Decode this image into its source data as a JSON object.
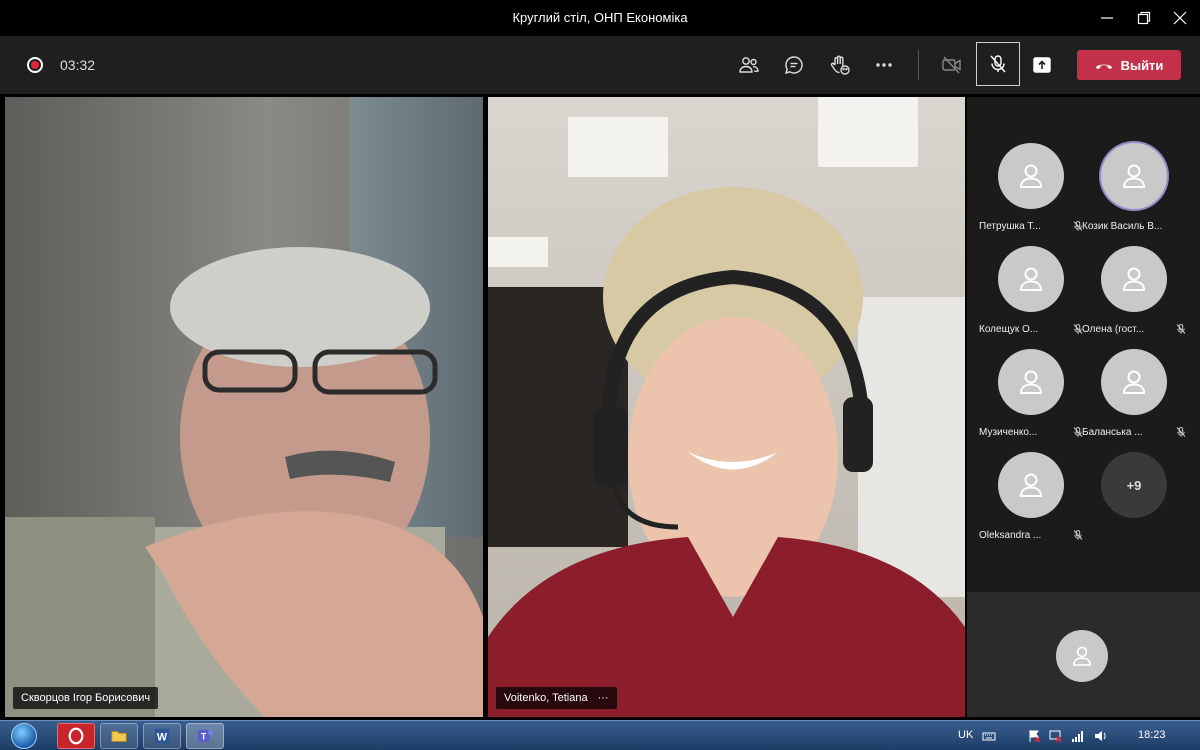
{
  "window": {
    "title": "Круглий стіл, ОНП Економіка"
  },
  "toolbar": {
    "timer": "03:32",
    "leave_label": "Выйти"
  },
  "tiles": [
    {
      "name": "Скворцов Ігор Борисович"
    },
    {
      "name": "Voitenko, Tetiana",
      "more": "···"
    }
  ],
  "participants": [
    {
      "name": "Петрушка Т...",
      "muted": true
    },
    {
      "name": "Козик Василь В...",
      "muted": false,
      "active": true
    },
    {
      "name": "Колещук О...",
      "muted": true
    },
    {
      "name": "Олена (гост...",
      "muted": true
    },
    {
      "name": "Музиченко...",
      "muted": true
    },
    {
      "name": "Баланська ...",
      "muted": true
    },
    {
      "name": "Oleksandra ...",
      "muted": true
    }
  ],
  "overflow_count": "+9",
  "taskbar": {
    "language": "UK",
    "time": "18:23"
  },
  "colors": {
    "leave": "#c4314b",
    "record": "#e0243a",
    "active_ring": "#8b8cc7"
  }
}
